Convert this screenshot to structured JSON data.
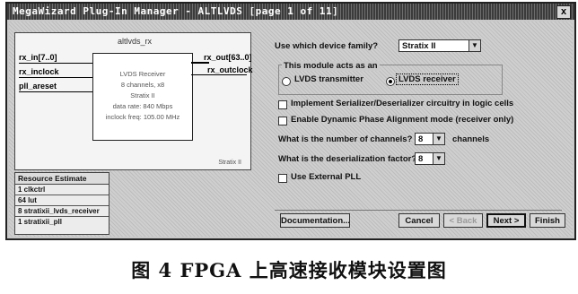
{
  "window": {
    "title": "MegaWizard Plug-In Manager - ALTLVDS [page 1 of 11]",
    "close_glyph": "x"
  },
  "diagram": {
    "block_title": "altlvds_rx",
    "inputs": [
      "rx_in[7..0]",
      "rx_inclock",
      "pll_areset"
    ],
    "outputs": [
      "rx_out[63..0]",
      "rx_outclock"
    ],
    "desc_lines": [
      "LVDS Receiver",
      "8 channels, x8",
      "Stratix II",
      "data rate: 840 Mbps",
      "inclock freq: 105.00 MHz"
    ],
    "corner_tag": "Stratix II"
  },
  "resource": {
    "header": "Resource Estimate",
    "items": [
      "1 clkctrl",
      "64 lut",
      "8 stratixii_lvds_receiver",
      "1 stratixii_pll"
    ]
  },
  "settings": {
    "device_family_label": "Use which device family?",
    "device_family_value": "Stratix II",
    "mode_group_label": "This module acts as an",
    "mode_options": [
      "LVDS transmitter",
      "LVDS receiver"
    ],
    "selected_mode": "LVDS receiver",
    "serdes_logic_label": "Implement Serializer/Deserializer circuitry in logic cells",
    "dpa_label": "Enable Dynamic Phase Alignment mode (receiver only)",
    "channels_label": "What is the number of channels?",
    "channels_value": "8",
    "channels_suffix": "channels",
    "deser_label": "What is the deserialization factor?",
    "deser_value": "8",
    "external_pll_label": "Use External PLL"
  },
  "buttons": {
    "documentation": "Documentation...",
    "cancel": "Cancel",
    "back": "< Back",
    "next": "Next >",
    "finish": "Finish"
  },
  "caption": "图 4   FPGA 上高速接收模块设置图"
}
